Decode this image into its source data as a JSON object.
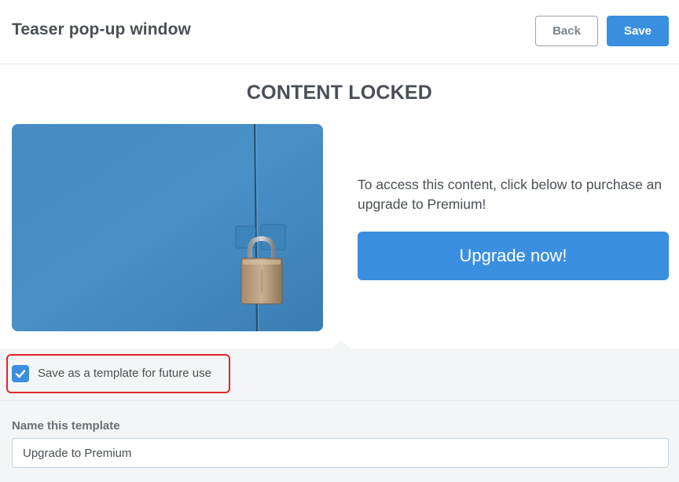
{
  "header": {
    "title": "Teaser pop-up window",
    "back_label": "Back",
    "save_label": "Save"
  },
  "content": {
    "heading": "CONTENT LOCKED",
    "image_icon": "padlock-on-blue-door-image",
    "promo_text": "To access this content, click below to purchase an upgrade to Premium!",
    "upgrade_label": "Upgrade now!"
  },
  "template": {
    "checkbox_checked": true,
    "checkbox_label": "Save as a template for future use",
    "name_label": "Name this template",
    "name_value": "Upgrade to Premium"
  },
  "colors": {
    "accent": "#3b8fe0",
    "highlight": "#e0262b",
    "panel_bg": "#f4f5f6"
  }
}
